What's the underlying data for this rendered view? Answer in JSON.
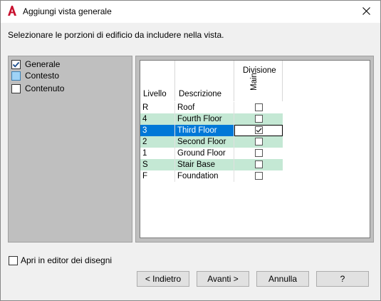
{
  "window": {
    "title": "Aggiungi vista generale",
    "close_glyph": "✕",
    "app_icon": "autocad-a-icon"
  },
  "instruction": "Selezionare le porzioni di edificio da includere nella vista.",
  "tree": {
    "items": [
      {
        "label": "Generale",
        "state": "checked"
      },
      {
        "label": "Contesto",
        "state": "partial"
      },
      {
        "label": "Contenuto",
        "state": "unchecked"
      }
    ]
  },
  "grid": {
    "group_header": "Divisione",
    "columns": {
      "level": "Livello",
      "description": "Descrizione",
      "division": "Main"
    },
    "rows": [
      {
        "level": "R",
        "description": "Roof",
        "checked": false,
        "style": "normal"
      },
      {
        "level": "4",
        "description": "Fourth Floor",
        "checked": false,
        "style": "alt"
      },
      {
        "level": "3",
        "description": "Third Floor",
        "checked": true,
        "style": "selected"
      },
      {
        "level": "2",
        "description": "Second Floor",
        "checked": false,
        "style": "alt"
      },
      {
        "level": "1",
        "description": "Ground Floor",
        "checked": false,
        "style": "normal"
      },
      {
        "level": "S",
        "description": "Stair Base",
        "checked": false,
        "style": "alt"
      },
      {
        "level": "F",
        "description": "Foundation",
        "checked": false,
        "style": "normal"
      }
    ]
  },
  "open_in_editor": {
    "label": "Apri in editor dei disegni",
    "checked": false
  },
  "buttons": {
    "back": "< Indietro",
    "next": "Avanti >",
    "cancel": "Annulla",
    "help": "?"
  },
  "colors": {
    "selection": "#0078d7",
    "alt_row": "#c4e8d4",
    "panel_gray": "#bfbfbf",
    "app_icon_red": "#c8102e"
  }
}
